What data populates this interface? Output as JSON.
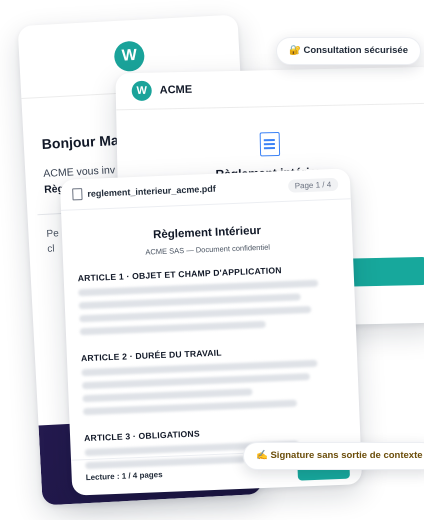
{
  "email": {
    "greeting": "Bonjour Ma",
    "intro_line1": "ACME vous inv",
    "intro_line2": "Règlement int",
    "body_line1": "Pe",
    "body_line2": "cl"
  },
  "badges": {
    "secure": "🔐 Consultation sécurisée",
    "signature": "✍️ Signature sans sortie de contexte"
  },
  "acme": {
    "company": "ACME",
    "logo_letter": "W",
    "ghost_title": "Règlement intérieur"
  },
  "viewer": {
    "filename": "reglement_interieur_acme.pdf",
    "page_indicator": "Page 1 / 4",
    "doc_title": "Règlement Intérieur",
    "doc_subtitle": "ACME SAS — Document confidentiel",
    "articles": [
      "ARTICLE 1 · OBJET ET CHAMP D'APPLICATION",
      "ARTICLE 2 · DURÉE DU TRAVAIL",
      "ARTICLE 3 · OBLIGATIONS"
    ],
    "footer_status": "Lecture : 1 / 4 pages"
  },
  "colors": {
    "teal": "#17a89c",
    "dark_footer": "#241a4f",
    "doc_icon": "#3b82f6"
  }
}
